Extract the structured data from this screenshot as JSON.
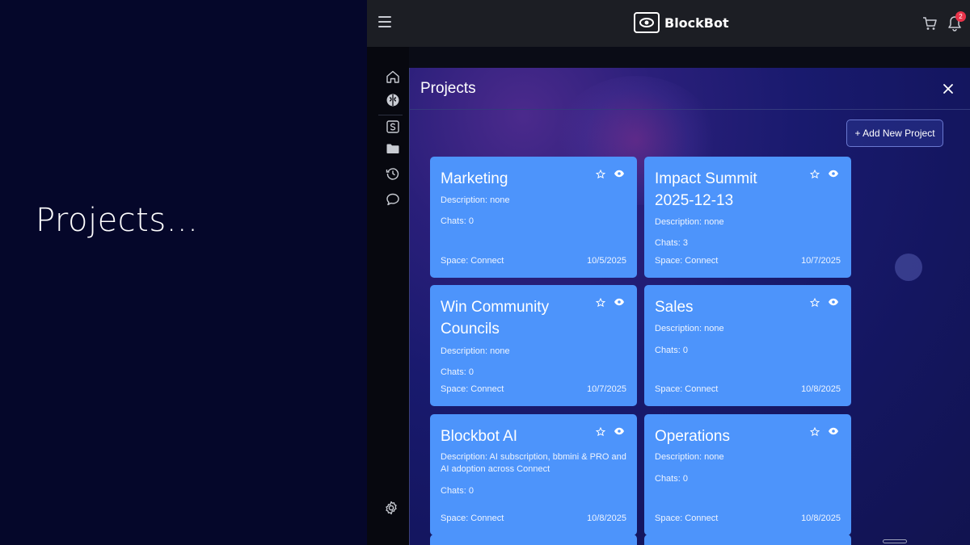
{
  "caption": "Projects...",
  "app": {
    "brand": "BlockBot",
    "notification_count": "2"
  },
  "panel": {
    "title": "Projects",
    "add_button": "+ Add New Project"
  },
  "cards": [
    {
      "title": "Marketing",
      "description": "Description: none",
      "chats": "Chats: 0",
      "space": "Space: Connect",
      "date": "10/5/2025"
    },
    {
      "title": "Impact Summit 2025-12-13",
      "description": "Description: none",
      "chats": "Chats: 3",
      "space": "Space: Connect",
      "date": "10/7/2025"
    },
    {
      "title": "Win Community Councils",
      "description": "Description: none",
      "chats": "Chats: 0",
      "space": "Space: Connect",
      "date": "10/7/2025"
    },
    {
      "title": "Sales",
      "description": "Description: none",
      "chats": "Chats: 0",
      "space": "Space: Connect",
      "date": "10/8/2025"
    },
    {
      "title": "Blockbot AI",
      "description": "Description: AI subscription, bbmini & PRO and AI adoption across Connect",
      "chats": "Chats: 0",
      "space": "Space: Connect",
      "date": "10/8/2025"
    },
    {
      "title": "Operations",
      "description": "Description: none",
      "chats": "Chats: 0",
      "space": "Space: Connect",
      "date": "10/8/2025"
    }
  ],
  "icons": {
    "menu": "hamburger-menu-icon",
    "cart": "cart-icon",
    "bell": "bell-icon",
    "home": "home-icon",
    "brain": "brain-icon",
    "space": "s-square-icon",
    "folder": "folder-icon",
    "history": "history-icon",
    "chat": "chat-bubble-icon",
    "settings": "gear-icon",
    "close": "close-icon",
    "star": "star-icon",
    "eye": "eye-icon"
  },
  "colors": {
    "card": "#4d94fb",
    "page_bg": "#05072a",
    "badge": "#e8334a"
  }
}
